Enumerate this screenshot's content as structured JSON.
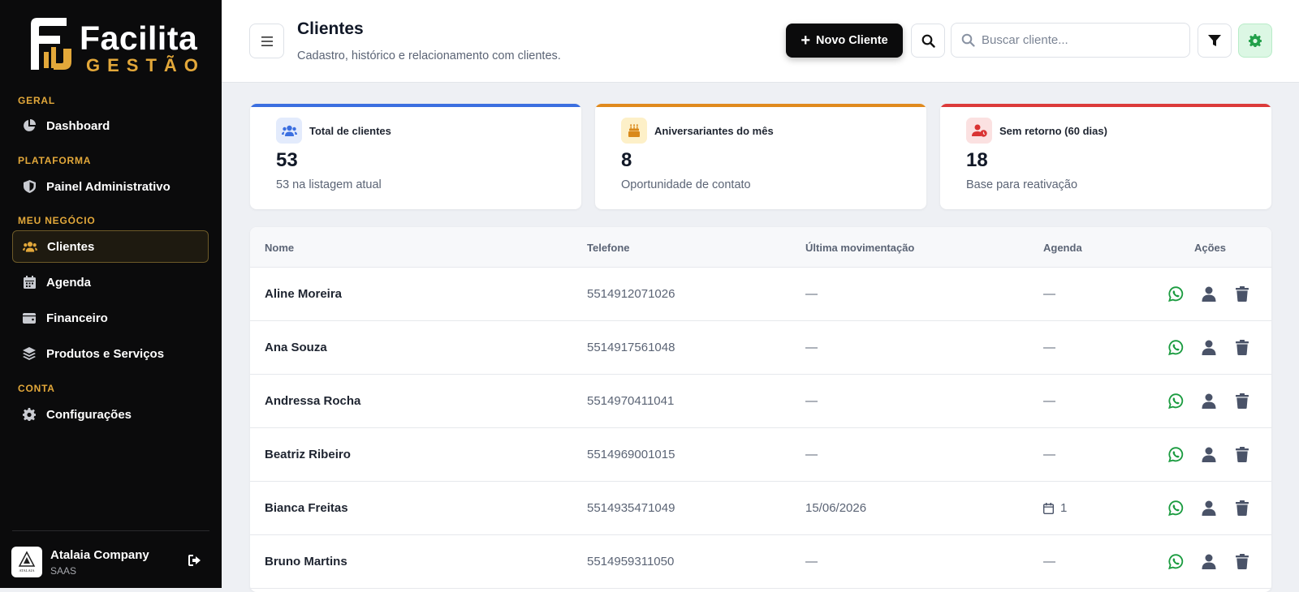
{
  "brand": {
    "name_line1": "Facilita",
    "name_line2": "GESTÃO",
    "accent": "#e3a83a"
  },
  "sidebar": {
    "sections": [
      {
        "label": "GERAL"
      },
      {
        "label": "PLATAFORMA"
      },
      {
        "label": "MEU NEGÓCIO"
      },
      {
        "label": "CONTA"
      }
    ],
    "items": [
      {
        "label": "Dashboard",
        "icon": "pie-chart-icon"
      },
      {
        "label": "Painel Administrativo",
        "icon": "shield-icon"
      },
      {
        "label": "Clientes",
        "icon": "users-icon",
        "active": true
      },
      {
        "label": "Agenda",
        "icon": "calendar-icon"
      },
      {
        "label": "Financeiro",
        "icon": "wallet-icon"
      },
      {
        "label": "Produtos e Serviços",
        "icon": "layers-icon"
      },
      {
        "label": "Configurações",
        "icon": "gear-icon"
      }
    ],
    "account": {
      "avatar_text": "ATALAIA",
      "name": "Atalaia Company",
      "plan": "SAAS"
    }
  },
  "header": {
    "title": "Clientes",
    "subtitle": "Cadastro, histórico e relacionamento com clientes.",
    "new_button": "Novo Cliente",
    "search_placeholder": "Buscar cliente..."
  },
  "stats": [
    {
      "label": "Total de clientes",
      "value": "53",
      "note": "53 na listagem atual",
      "color": "#3b6fe0",
      "icon": "users-icon"
    },
    {
      "label": "Aniversariantes do mês",
      "value": "8",
      "note": "Oportunidade de contato",
      "color": "#e08a1e",
      "icon": "birthday-cake-icon"
    },
    {
      "label": "Sem retorno (60 dias)",
      "value": "18",
      "note": "Base para reativação",
      "color": "#dc3a3a",
      "icon": "user-clock-icon"
    }
  ],
  "table": {
    "columns": [
      "Nome",
      "Telefone",
      "Última movimentação",
      "Agenda",
      "Ações"
    ],
    "rows": [
      {
        "name": "Aline Moreira",
        "phone": "5514912071026",
        "last": "—",
        "agenda": "—"
      },
      {
        "name": "Ana Souza",
        "phone": "5514917561048",
        "last": "—",
        "agenda": "—"
      },
      {
        "name": "Andressa Rocha",
        "phone": "5514970411041",
        "last": "—",
        "agenda": "—"
      },
      {
        "name": "Beatriz Ribeiro",
        "phone": "5514969001015",
        "last": "—",
        "agenda": "—"
      },
      {
        "name": "Bianca Freitas",
        "phone": "5514935471049",
        "last": "15/06/2026",
        "agenda": "1",
        "agenda_icon": true
      },
      {
        "name": "Bruno Martins",
        "phone": "5514959311050",
        "last": "—",
        "agenda": "—"
      }
    ]
  }
}
